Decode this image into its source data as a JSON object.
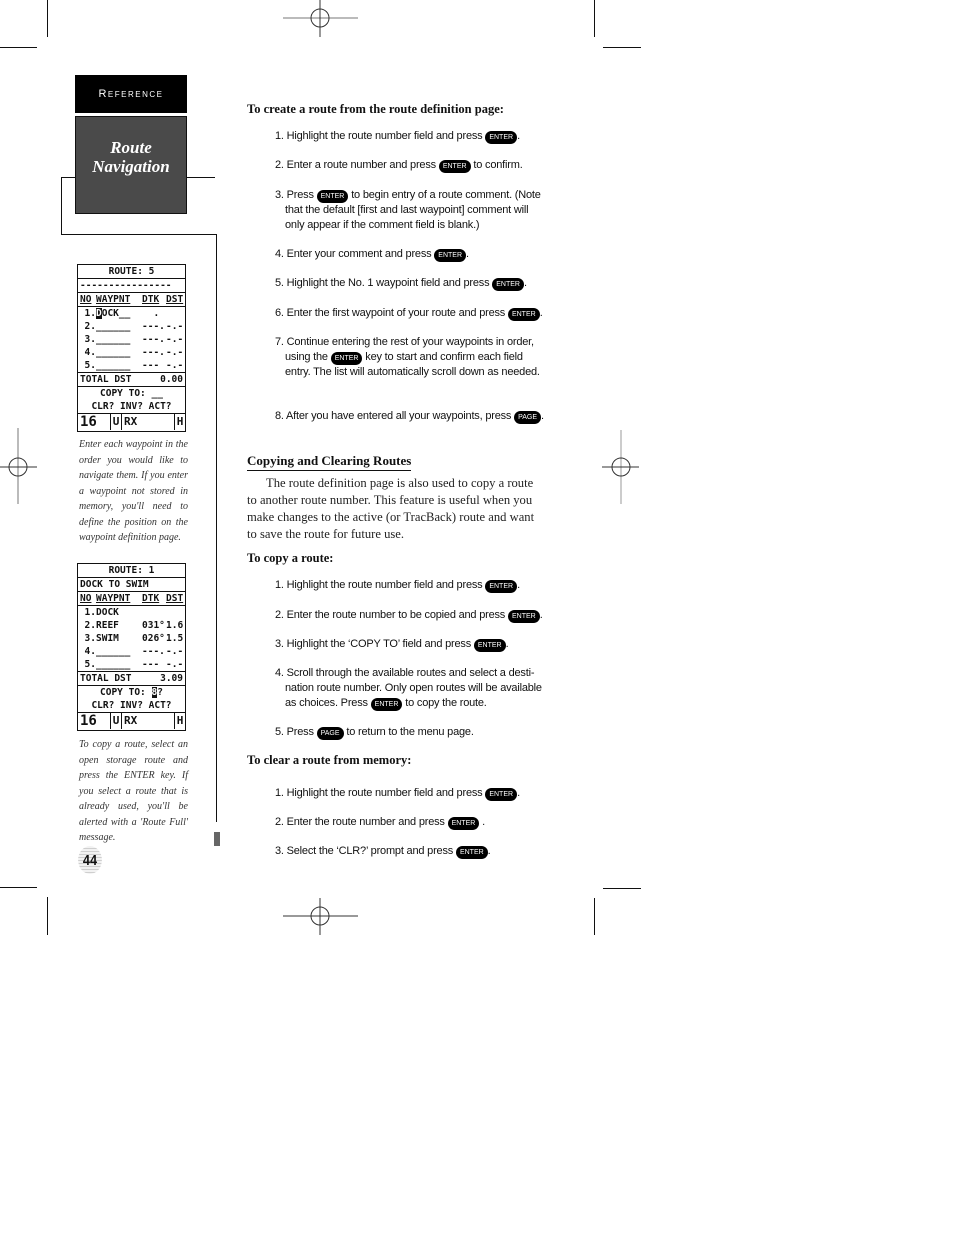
{
  "sidebar": {
    "section_tab": "Reference",
    "chapter_title_line1": "Route",
    "chapter_title_line2": "Navigation"
  },
  "screens": [
    {
      "title": "ROUTE: 5",
      "comment": "----------------",
      "headers": [
        "NO",
        "WAYPNT",
        "DTK",
        "DST"
      ],
      "rows": [
        {
          "no": "1.",
          "cursor": "D",
          "name": "OCK__",
          "dtk": "  .",
          "dst": ""
        },
        {
          "no": "2.",
          "cursor": "",
          "name": "______",
          "dtk": "---.",
          "dst": "-.-"
        },
        {
          "no": "3.",
          "cursor": "",
          "name": "______",
          "dtk": "---.",
          "dst": "-.-"
        },
        {
          "no": "4.",
          "cursor": "",
          "name": "______",
          "dtk": "---.",
          "dst": "-.-"
        },
        {
          "no": "5.",
          "cursor": "",
          "name": "______",
          "dtk": "---",
          "dst": "-.-"
        }
      ],
      "total_label": "TOTAL DST",
      "total_value": "0.00",
      "copy_to_label": "COPY TO:",
      "copy_to_value": "__",
      "options": "CLR? INV? ACT?",
      "status": {
        "num": "16",
        "mode": "U",
        "rx": "RX",
        "flag": "H"
      }
    },
    {
      "title": "ROUTE: 1",
      "comment": "DOCK TO SWIM",
      "headers": [
        "NO",
        "WAYPNT",
        "DTK",
        "DST"
      ],
      "rows": [
        {
          "no": "1.",
          "cursor": "",
          "name": "DOCK",
          "dtk": "",
          "dst": ""
        },
        {
          "no": "2.",
          "cursor": "",
          "name": "REEF",
          "dtk": "031°",
          "dst": "1.6"
        },
        {
          "no": "3.",
          "cursor": "",
          "name": "SWIM",
          "dtk": "026°",
          "dst": "1.5"
        },
        {
          "no": "4.",
          "cursor": "",
          "name": "______",
          "dtk": "---.",
          "dst": "-.-"
        },
        {
          "no": "5.",
          "cursor": "",
          "name": "______",
          "dtk": "---",
          "dst": "-.-"
        }
      ],
      "total_label": "TOTAL DST",
      "total_value": "3.09",
      "copy_to_label": "COPY TO:",
      "copy_to_value": "8",
      "copy_to_suffix": "?",
      "options": "CLR? INV? ACT?",
      "status": {
        "num": "16",
        "mode": "U",
        "rx": "RX",
        "flag": "H"
      }
    }
  ],
  "captions": [
    "Enter each waypoint in the order you would like to navigate them. If you enter a waypoint not stored in memory, you'll need to define the position on the waypoint definition page.",
    "To copy a route, select an open storage route and press the ENTER key. If you select a route that is already used, you'll be alerted with a 'Route Full' message."
  ],
  "page_number": "44",
  "keys": {
    "enter": "ENTER",
    "page": "PAGE"
  },
  "create": {
    "heading": "To create a route from the route definition page:",
    "steps": [
      {
        "pre": "1. Highlight the route number field and press",
        "key": "ENTER",
        "post": "."
      },
      {
        "pre": "2. Enter a route number and press",
        "key": "ENTER",
        "post": " to confirm."
      },
      {
        "pre": "3. Press",
        "key": "ENTER",
        "post": " to begin entry of a route comment. (Note that the default [first and last waypoint] comment will only appear if the comment field is blank.)"
      },
      {
        "pre": "4. Enter your comment and press",
        "key": "ENTER",
        "post": "."
      },
      {
        "pre": "5. Highlight the No. 1 waypoint field and press",
        "key": "ENTER",
        "post": "."
      },
      {
        "pre": "6. Enter the first waypoint of your route and press",
        "key": "ENTER",
        "post": "."
      },
      {
        "pre": "7. Continue entering the rest of your waypoints in order, using the",
        "key": "ENTER",
        "post": " key to start and confirm each field entry. The list will automatically scroll down as needed."
      },
      {
        "pre": "8. After you have entered all your waypoints, press",
        "key": "PAGE",
        "post": "."
      }
    ]
  },
  "copying": {
    "section_heading": "Copying and Clearing Routes",
    "paragraph": "The route definition page is also used to copy a route to another route number. This feature is useful when you make changes to the active (or TracBack) route and want to save the route for future use.",
    "heading": "To copy a route:",
    "steps": [
      {
        "pre": "1. Highlight the route number field and press",
        "key": "ENTER",
        "post": "."
      },
      {
        "pre": "2. Enter the route number to be copied and press",
        "key": "ENTER",
        "post": "."
      },
      {
        "pre": "3. Highlight the ‘COPY TO’ field and press",
        "key": "ENTER",
        "post": "."
      },
      {
        "pre": "4. Scroll through the available routes and select a desti-nation route number. Only open routes will be available as choices. Press",
        "key": "ENTER",
        "post": " to copy the route."
      },
      {
        "pre": "5. Press",
        "key": "PAGE",
        "post": " to return to the menu page."
      }
    ]
  },
  "clearing": {
    "heading": "To clear a route from memory:",
    "steps": [
      {
        "pre": "1. Highlight the route number field and press",
        "key": "ENTER",
        "post": "."
      },
      {
        "pre": "2. Enter the route number and press",
        "key": "ENTER",
        "post": " ."
      },
      {
        "pre": "3. Select the ‘CLR?’ prompt and press",
        "key": "ENTER",
        "post": "."
      }
    ]
  }
}
